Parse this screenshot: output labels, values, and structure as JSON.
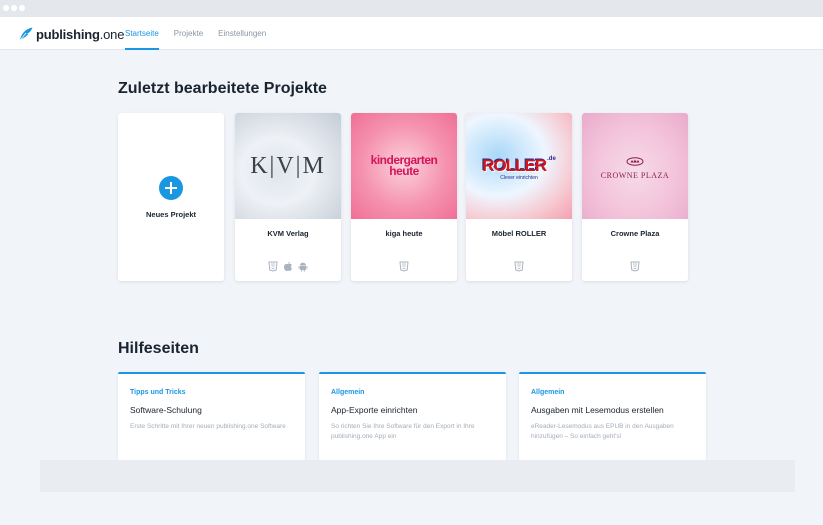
{
  "app": {
    "logo_bold": "publishing",
    "logo_light": ".one"
  },
  "nav": {
    "tabs": [
      {
        "label": "Startseite",
        "active": true
      },
      {
        "label": "Projekte",
        "active": false
      },
      {
        "label": "Einstellungen",
        "active": false
      }
    ]
  },
  "recent": {
    "title": "Zuletzt bearbeitete Projekte",
    "new_project_label": "Neues Projekt",
    "projects": [
      {
        "name": "KVM Verlag",
        "thumb_text": "K|V|M",
        "icons": [
          "html5-icon",
          "apple-icon",
          "android-icon"
        ]
      },
      {
        "name": "kiga heute",
        "thumb_text_1": "kindergarten",
        "thumb_text_2": "heute",
        "icons": [
          "html5-icon"
        ]
      },
      {
        "name": "Möbel ROLLER",
        "thumb_text": "ROLLER",
        "thumb_suffix": ".de",
        "thumb_sub": "Clever einrichten",
        "icons": [
          "html5-icon"
        ]
      },
      {
        "name": "Crowne Plaza",
        "thumb_text": "CROWNE PLAZA",
        "icons": [
          "html5-icon"
        ]
      }
    ]
  },
  "help": {
    "title": "Hilfeseiten",
    "cards": [
      {
        "category": "Tipps und Tricks",
        "title": "Software-Schulung",
        "description": "Erste Schritte mit Ihrer neuen publishing.one Software"
      },
      {
        "category": "Allgemein",
        "title": "App-Exporte einrichten",
        "description": "So richten Sie Ihre Software für den Export in Ihre publishing.one App ein"
      },
      {
        "category": "Allgemein",
        "title": "Ausgaben mit Lesemodus erstellen",
        "description": "eReader-Lesemodus aus EPUB in den Ausgaben hinzufügen – So einfach geht's!"
      }
    ]
  },
  "colors": {
    "accent": "#1a97e0",
    "background": "#f1f4f8",
    "text": "#1a2330",
    "muted": "#a3adb8"
  }
}
